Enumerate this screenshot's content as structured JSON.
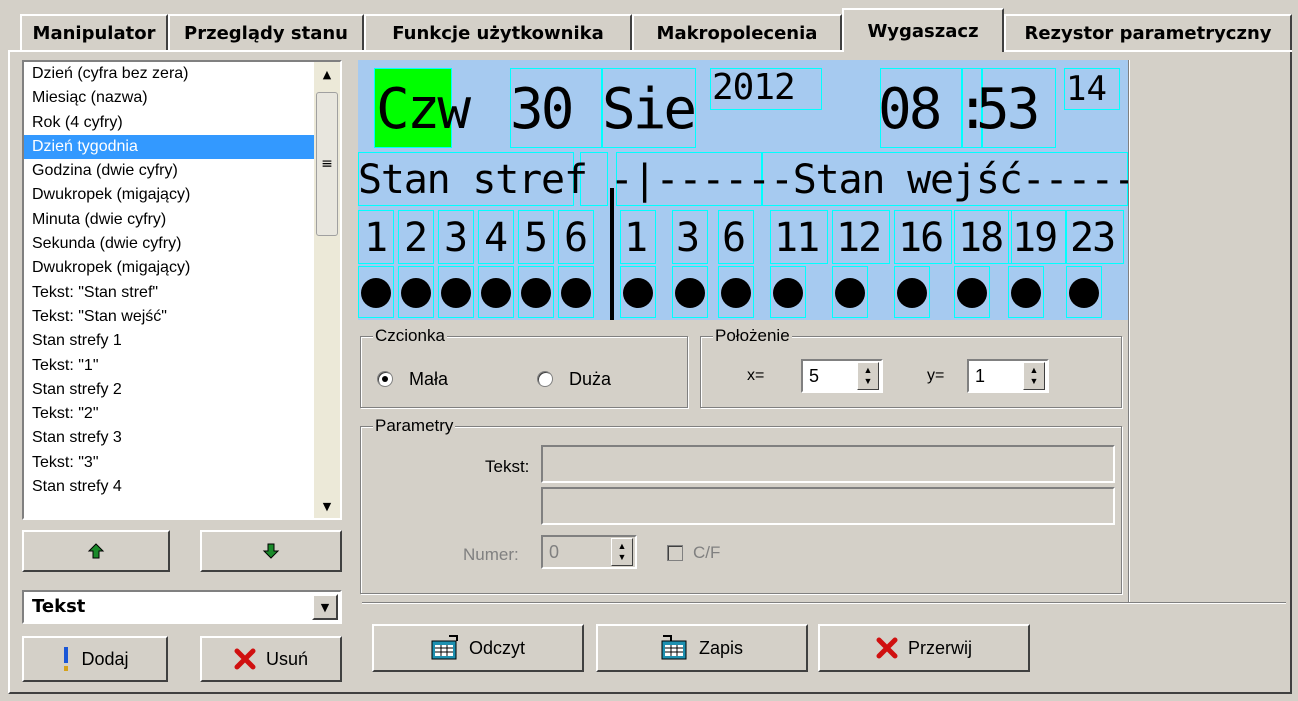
{
  "tabs": [
    {
      "label": "Manipulator"
    },
    {
      "label": "Przeglądy stanu"
    },
    {
      "label": "Funkcje użytkownika"
    },
    {
      "label": "Makropolecenia"
    },
    {
      "label": "Wygaszacz",
      "active": true
    },
    {
      "label": "Rezystor parametryczny"
    }
  ],
  "elements_list": {
    "items": [
      "Dzień (cyfra bez zera)",
      "Miesiąc (nazwa)",
      "Rok (4 cyfry)",
      "Dzień tygodnia",
      "Godzina (dwie cyfry)",
      "Dwukropek (migający)",
      "Minuta (dwie cyfry)",
      "Sekunda (dwie cyfry)",
      "Dwukropek (migający)",
      "Tekst: \"Stan stref\"",
      "Tekst: \"Stan wejść\"",
      "Stan strefy 1",
      "Tekst: \"1\"",
      "Stan strefy 2",
      "Tekst: \"2\"",
      "Stan strefy 3",
      "Tekst: \"3\"",
      "Stan strefy 4"
    ],
    "selected_index": 3
  },
  "move_up_icon": "arrow-up-icon",
  "move_down_icon": "arrow-down-icon",
  "element_type": {
    "selected": "Tekst"
  },
  "buttons": {
    "add": "Dodaj",
    "remove": "Usuń",
    "read": "Odczyt",
    "write": "Zapis",
    "cancel": "Przerwij"
  },
  "lcd": {
    "day_of_week": "Czw",
    "day": "30",
    "month": "Sie",
    "year": "2012",
    "hours": "08",
    "colon": ":",
    "minutes": "53",
    "seconds": "14",
    "line2": "Stan stref -|------Stan wejść-----",
    "zone_labels": [
      "1",
      "2",
      "3",
      "4",
      "5",
      "6"
    ],
    "input_labels": [
      "1",
      "3",
      "6",
      "11",
      "12",
      "16",
      "18",
      "19",
      "23"
    ],
    "highlight_color": "#00ff00",
    "background_color": "#a6caf0",
    "cell_border_color": "#00ffff"
  },
  "font_group": {
    "title": "Czcionka",
    "small": "Mała",
    "large": "Duża",
    "selected": "Mała"
  },
  "position_group": {
    "title": "Położenie",
    "x_label": "x=",
    "x_value": "5",
    "y_label": "y=",
    "y_value": "1"
  },
  "params_group": {
    "title": "Parametry",
    "text_label": "Tekst:",
    "text_value": "",
    "text_value2": "",
    "number_label": "Numer:",
    "number_value": "0",
    "cf_label": "C/F",
    "cf_checked": false
  }
}
